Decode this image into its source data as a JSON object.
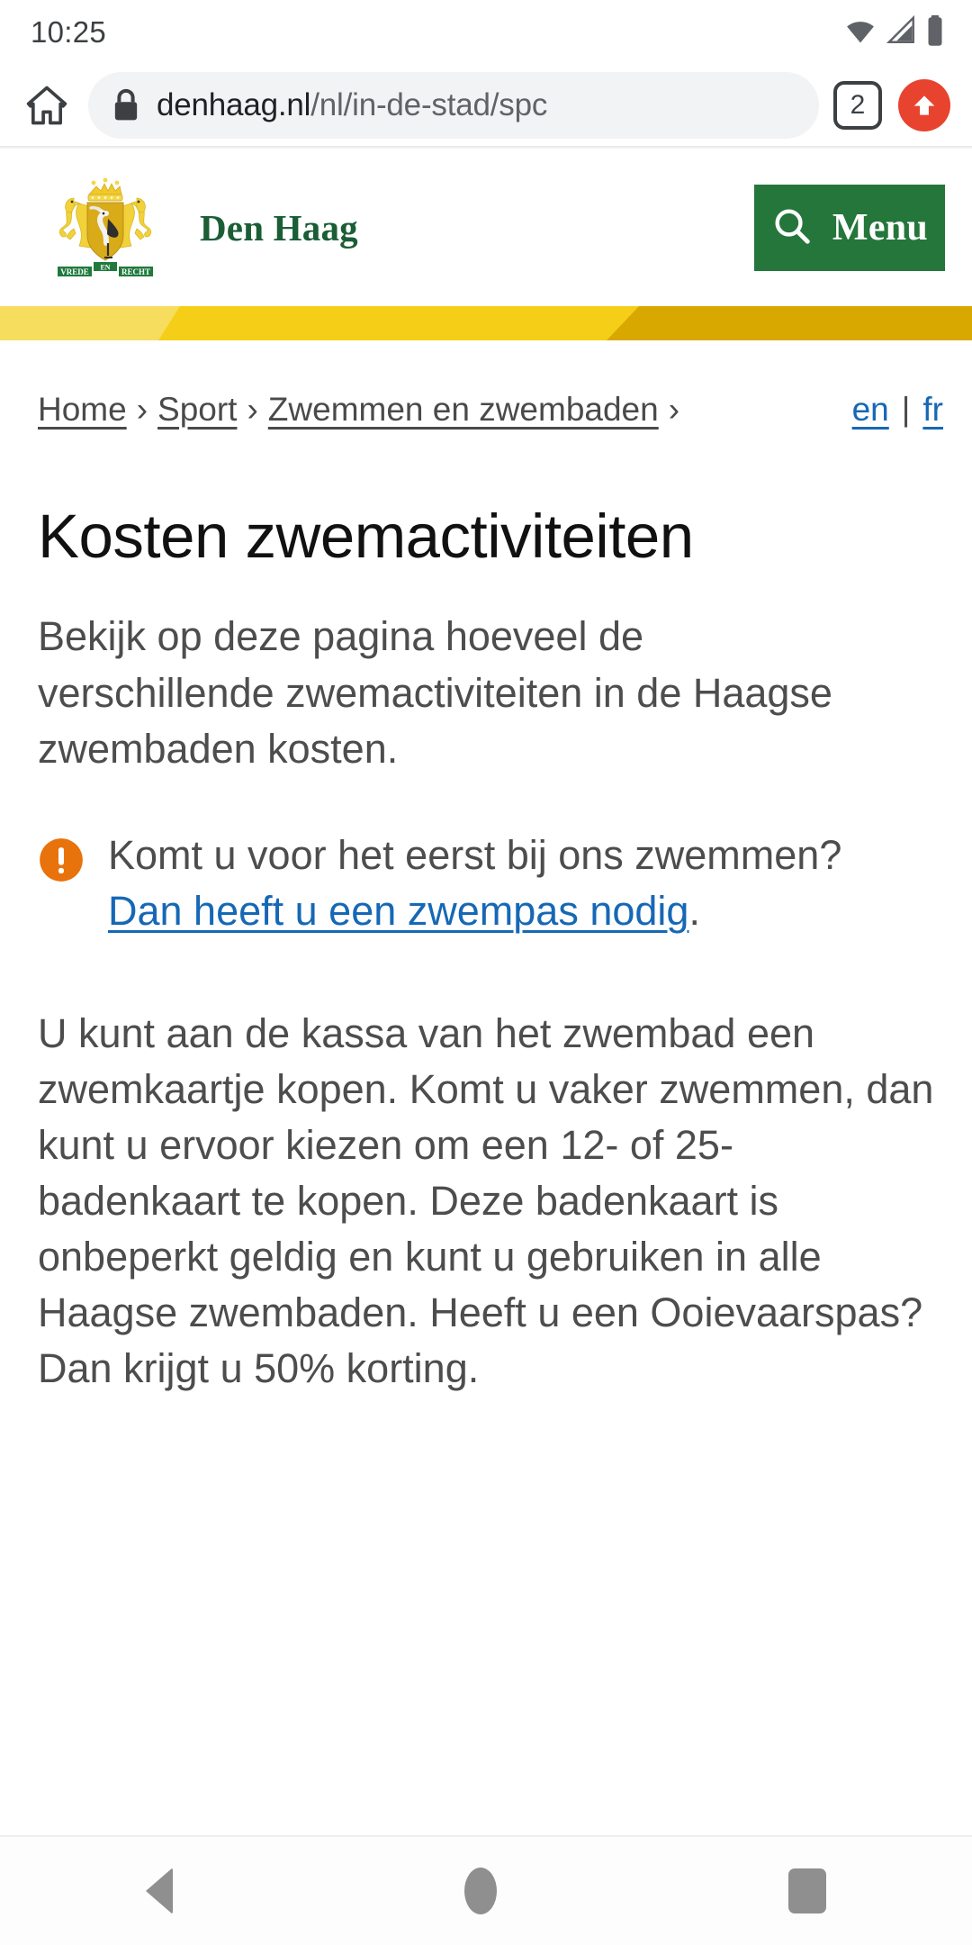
{
  "status_bar": {
    "time": "10:25",
    "icons": [
      "wifi-icon",
      "cellular-signal-icon",
      "battery-icon"
    ]
  },
  "browser": {
    "home_icon": "home-icon",
    "lock_icon": "lock-icon",
    "url_domain": "denhaag.nl",
    "url_path": "/nl/in-de-stad/spc",
    "tab_count": "2",
    "overflow_icon": "arrow-up-icon"
  },
  "site_header": {
    "logo_name": "den-haag-coat-of-arms",
    "motto_left": "VREDE",
    "motto_mid": "EN",
    "motto_right": "RECHT",
    "site_name": "Den Haag",
    "menu_label": "Menu",
    "search_icon": "search-icon",
    "brand_green": "#24763A",
    "gold_light": "#F7DD5E",
    "gold_mid": "#F5CE18",
    "gold_dark": "#D9A800"
  },
  "breadcrumb": {
    "items": [
      {
        "label": "Home"
      },
      {
        "label": "Sport"
      },
      {
        "label": "Zwemmen en zwembaden"
      }
    ],
    "separator": "›",
    "trailing": "›",
    "languages": [
      {
        "label": "en"
      },
      {
        "label": "fr"
      }
    ],
    "lang_divider": "|",
    "link_blue": "#1668B5"
  },
  "main": {
    "title": "Kosten zwemactiviteiten",
    "intro": "Bekijk op deze pagina hoeveel de verschillende zwemactiviteiten in de Haagse zwembaden kosten.",
    "notice": {
      "icon": "alert-exclamation-icon",
      "icon_color": "#E8720C",
      "text_before": "Komt u voor het eerst bij ons zwemmen? ",
      "link_text": "Dan heeft u een zwempas nodig",
      "text_after": "."
    },
    "body": "U kunt aan de kassa van het zwembad een zwemkaartje kopen. Komt u vaker zwemmen, dan kunt u ervoor kiezen om een 12- of 25-badenkaart te kopen. Deze badenkaart is onbeperkt geldig en kunt u gebruiken in alle Haagse zwembaden. Heeft u een Ooievaarspas? Dan krijgt u 50% korting."
  },
  "android_nav": {
    "back": "back-button",
    "home": "home-button",
    "recents": "recents-button"
  }
}
